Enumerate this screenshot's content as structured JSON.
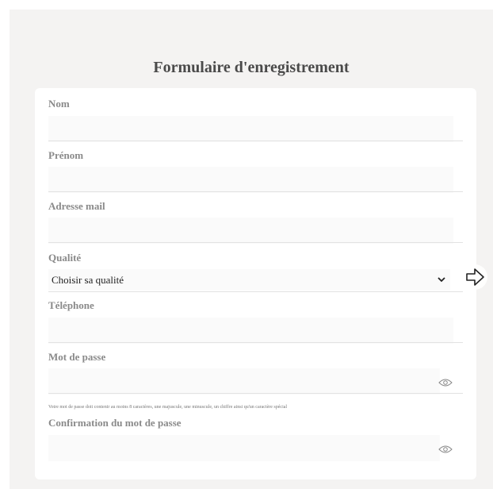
{
  "form": {
    "title": "Formulaire d'enregistrement",
    "fields": {
      "nom": {
        "label": "Nom",
        "value": ""
      },
      "prenom": {
        "label": "Prénom",
        "value": ""
      },
      "email": {
        "label": "Adresse mail",
        "value": ""
      },
      "qualite": {
        "label": "Qualité",
        "selected": "Choisir sa qualité"
      },
      "telephone": {
        "label": "Téléphone",
        "value": ""
      },
      "password": {
        "label": "Mot de passe",
        "value": "",
        "hint": "Votre mot de passe doit contenir au moins 8 caractères, une majuscule, une minuscule, un chiffre ainsi qu'un caractère spécial"
      },
      "password_confirm": {
        "label": "Confirmation du mot de passe",
        "value": ""
      }
    }
  },
  "icons": {
    "toggle_password": "eye-icon",
    "select_arrow": "chevron-down-icon",
    "pointer": "arrow-right-icon"
  },
  "colors": {
    "background": "#f4f3f2",
    "card": "#ffffff",
    "field": "#fafafa",
    "label": "#8a8a8a"
  }
}
